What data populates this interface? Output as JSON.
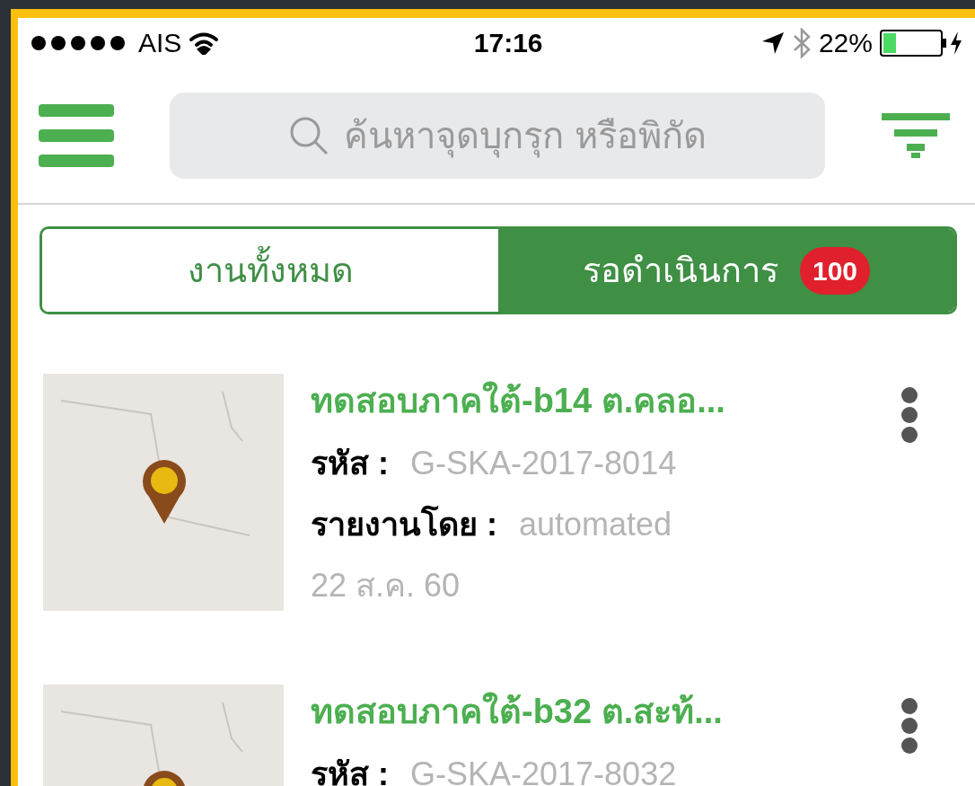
{
  "status_bar": {
    "carrier": "AIS",
    "time": "17:16",
    "battery": "22%"
  },
  "search": {
    "placeholder": "ค้นหาจุดบุกรุก หรือพิกัด"
  },
  "tabs": [
    {
      "label": "งานทั้งหมด",
      "selected": false
    },
    {
      "label": "รอดำเนินการ",
      "selected": true,
      "badge": "100"
    }
  ],
  "items": [
    {
      "title": "ทดสอบภาคใต้-b14 ต.คลอ...",
      "code_label": "รหัส :",
      "code": "G-SKA-2017-8014",
      "reporter_label": "รายงานโดย :",
      "reporter": "automated",
      "date": "22 ส.ค. 60"
    },
    {
      "title": "ทดสอบภาคใต้-b32 ต.สะท้...",
      "code_label": "รหัส :",
      "code": "G-SKA-2017-8032"
    }
  ]
}
